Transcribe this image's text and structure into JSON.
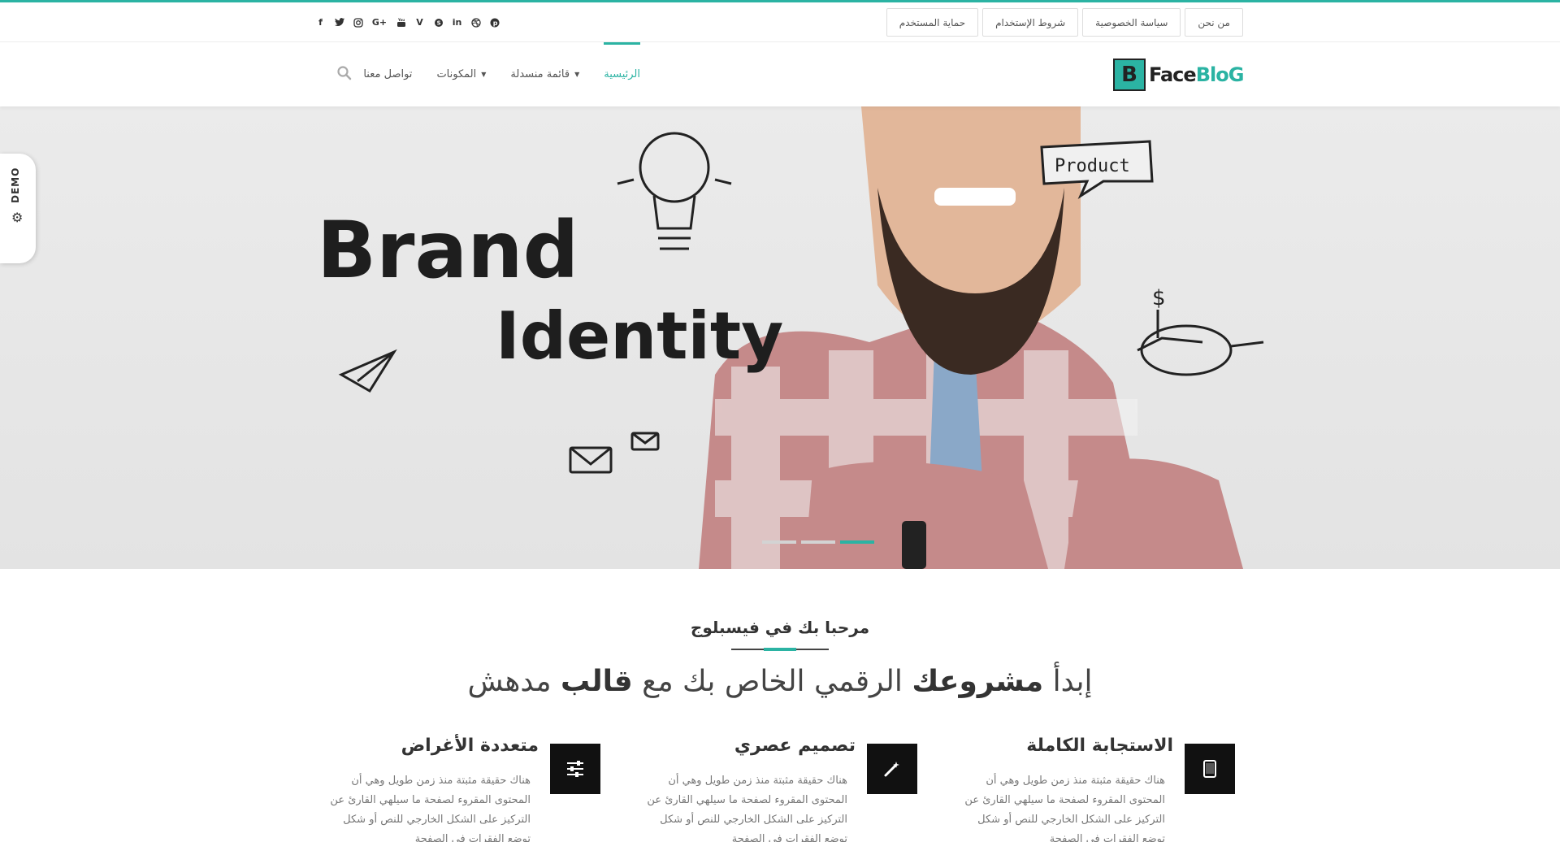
{
  "top_links": [
    "من نحن",
    "سياسة الخصوصية",
    "شروط الإستخدام",
    "حماية المستخدم"
  ],
  "socials": [
    "facebook-icon",
    "twitter-icon",
    "instagram-icon",
    "google-plus-icon",
    "youtube-icon",
    "vimeo-icon",
    "skype-icon",
    "linkedin-icon",
    "dribbble-icon",
    "pinterest-icon"
  ],
  "logo": {
    "mark": "B",
    "text_face": "Face",
    "text_blog": "BloG"
  },
  "nav": {
    "items": [
      "الرئيسية",
      "قائمة منسدلة",
      "المكونات",
      "تواصل معنا"
    ]
  },
  "hero": {
    "demo_label": "DEMO",
    "brand_word_1": "Brand",
    "brand_word_2": "Identity",
    "product_bubble": "Product",
    "dollar_sign": "$"
  },
  "welcome": {
    "subtitle": "مرحبا بك في فيسبلوج",
    "headline_part1": "إبدأ",
    "headline_bold1": "مشروعك",
    "headline_part2": "الرقمي الخاص بك مع",
    "headline_bold2": "قالب",
    "headline_part3": "مدهش"
  },
  "features": [
    {
      "title": "الاستجابة الكاملة",
      "icon": "tablet-icon",
      "text": "هناك حقيقة مثبتة منذ زمن طويل وهي أن المحتوى المقروء لصفحة ما سيلهي القارئ عن التركيز على الشكل الخارجي للنص أو شكل توضع الفقرات في الصفحة"
    },
    {
      "title": "تصميم عصري",
      "icon": "magic-wand-icon",
      "text": "هناك حقيقة مثبتة منذ زمن طويل وهي أن المحتوى المقروء لصفحة ما سيلهي القارئ عن التركيز على الشكل الخارجي للنص أو شكل توضع الفقرات في الصفحة"
    },
    {
      "title": "متعددة الأغراض",
      "icon": "sliders-icon",
      "text": "هناك حقيقة مثبتة منذ زمن طويل وهي أن المحتوى المقروء لصفحة ما سيلهي القارئ عن التركيز على الشكل الخارجي للنص أو شكل توضع الفقرات في الصفحة"
    }
  ],
  "colors": {
    "accent": "#2bb3a3",
    "dark": "#111111",
    "text": "#444444"
  }
}
